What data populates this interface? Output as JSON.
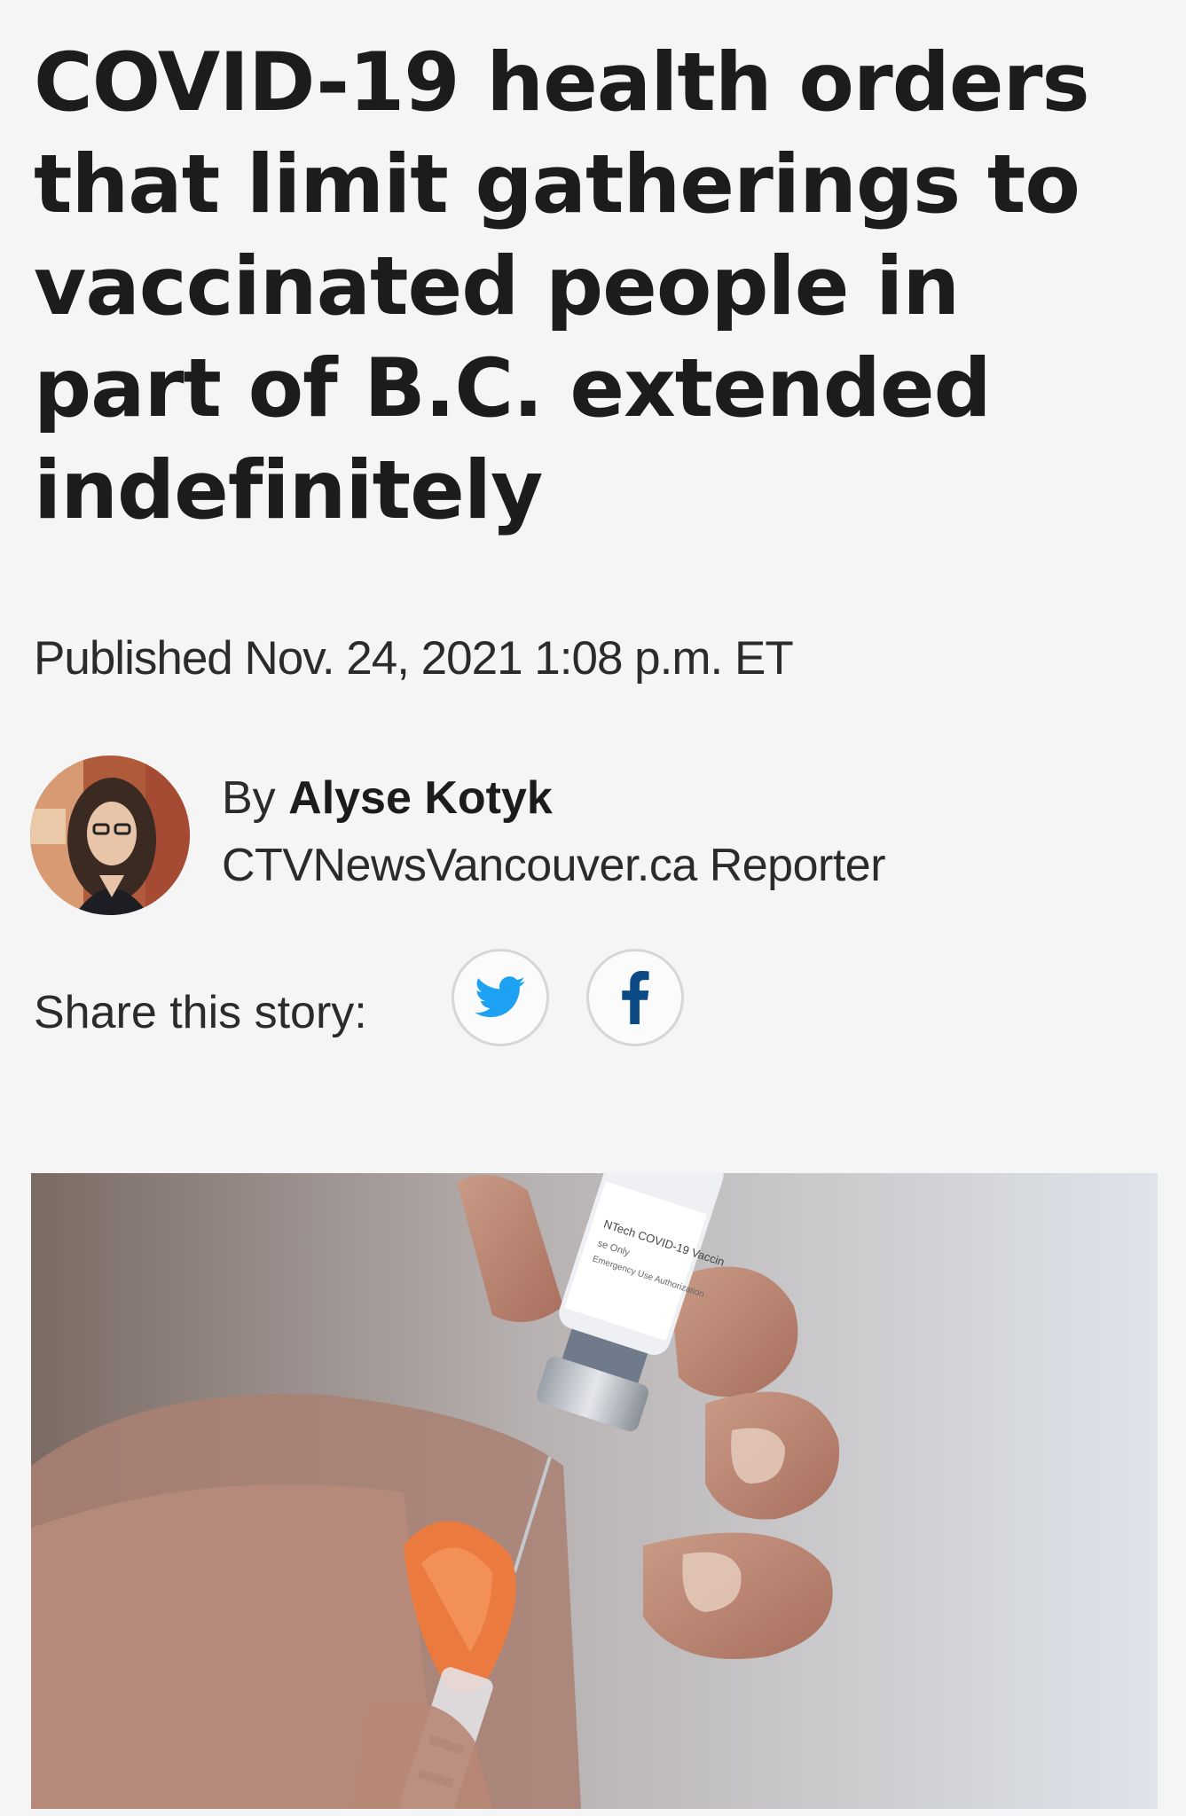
{
  "article": {
    "headline": "COVID-19 health orders that limit gatherings to vaccinated people in part of B.C. extended indefinitely",
    "published": "Published Nov. 24, 2021 1:08 p.m. ET"
  },
  "author": {
    "by_prefix": "By",
    "name": "Alyse Kotyk",
    "role": "CTVNewsVancouver.ca Reporter"
  },
  "share": {
    "label": "Share this story:",
    "buttons": [
      {
        "network": "twitter",
        "icon": "twitter-bird-icon",
        "color": "#1da1f2"
      },
      {
        "network": "facebook",
        "icon": "facebook-f-icon",
        "color": "#0c4a86"
      }
    ]
  },
  "hero_image": {
    "vial_label_lines": [
      "NTech COVID-19 Vaccin",
      "se Only",
      "Emergency Use Authorization"
    ]
  },
  "colors": {
    "background": "#f5f5f5",
    "text": "#1c1c1c",
    "twitter": "#1da1f2",
    "facebook": "#0c4a86",
    "syringe_cap": "#f07a3a"
  }
}
